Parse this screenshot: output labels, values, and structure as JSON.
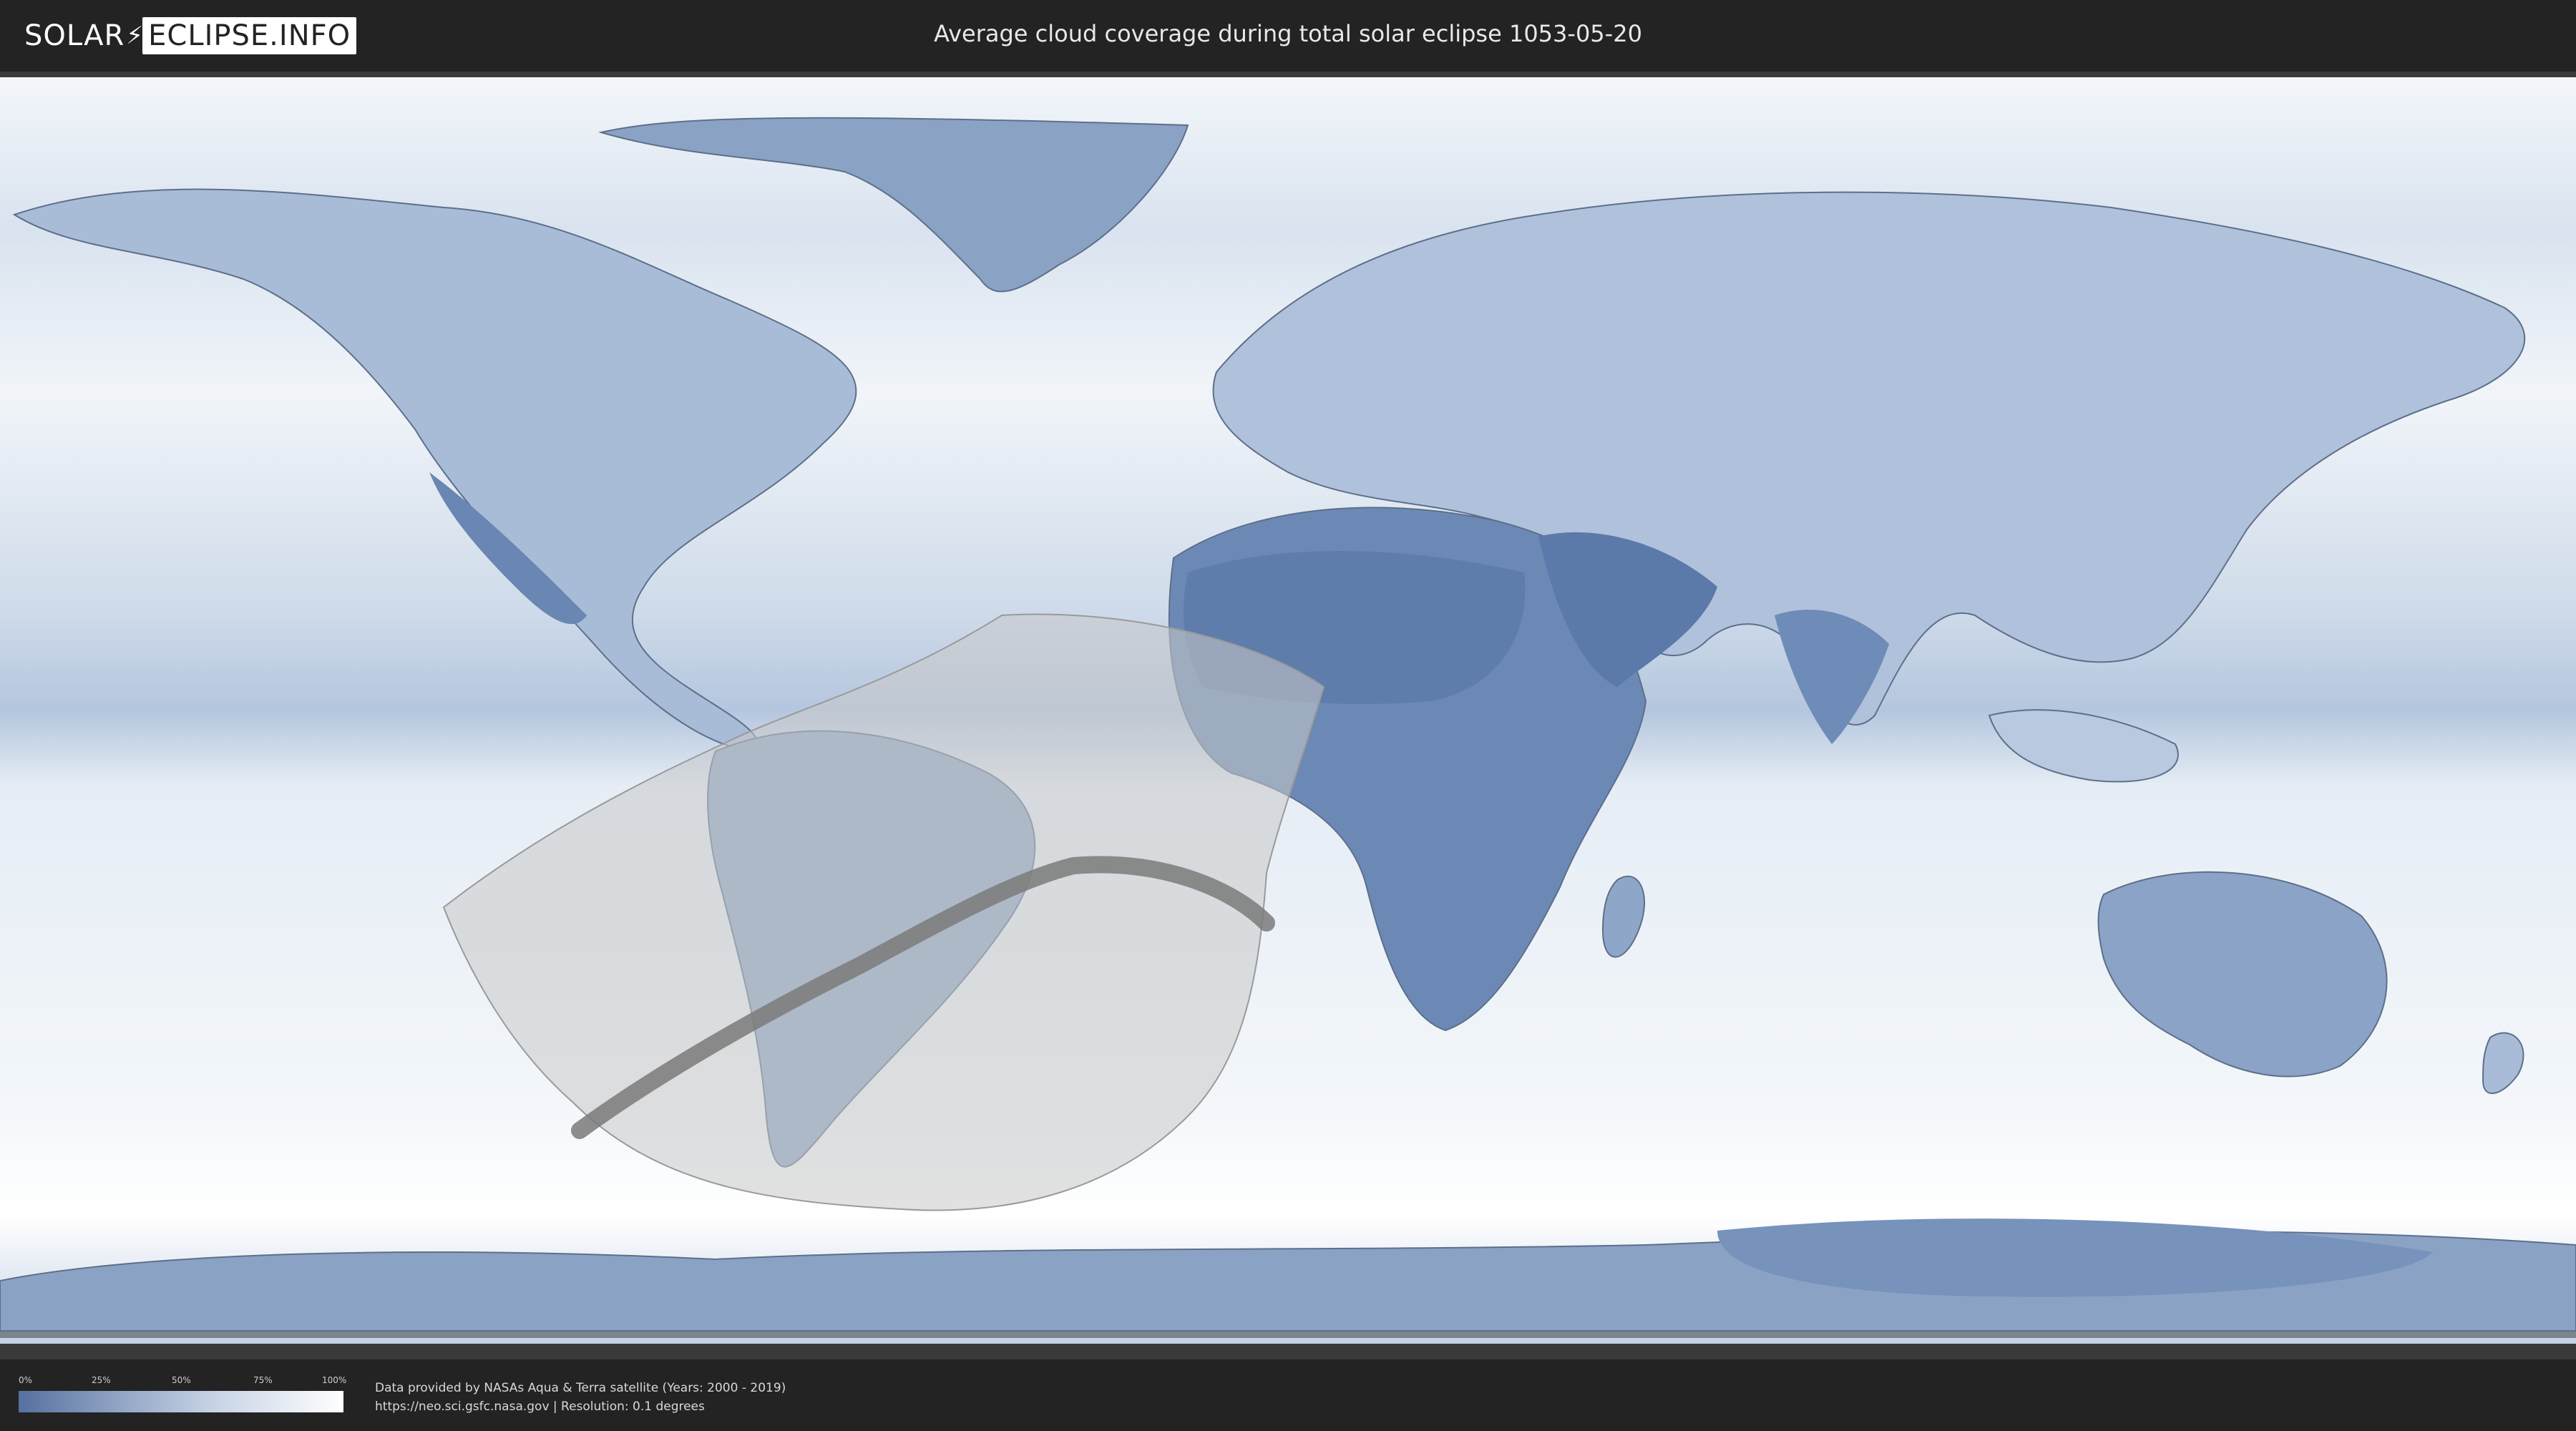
{
  "header": {
    "logo_part1": "SOLAR",
    "logo_part2": "ECLIPSE.INFO",
    "title": "Average cloud coverage during total solar eclipse 1053-05-20"
  },
  "legend": {
    "ticks": [
      "0%",
      "25%",
      "50%",
      "75%",
      "100%"
    ],
    "colors": {
      "low": "#5670a0",
      "high": "#ffffff"
    }
  },
  "footer": {
    "credit_line1": "Data provided by NASAs Aqua & Terra satellite (Years: 2000 - 2019)",
    "credit_line2": "https://neo.sci.gsfc.nasa.gov | Resolution: 0.1 degrees"
  },
  "map": {
    "projection": "equirectangular",
    "layers": [
      "cloud-coverage",
      "country-borders",
      "penumbra-region",
      "totality-path"
    ],
    "colors": {
      "ocean_clear": "#e7eef6",
      "cloud_dense": "#ffffff",
      "land_dry": "#5a79a8",
      "penumbra": "#c8c8c8",
      "totality": "#777777"
    }
  }
}
